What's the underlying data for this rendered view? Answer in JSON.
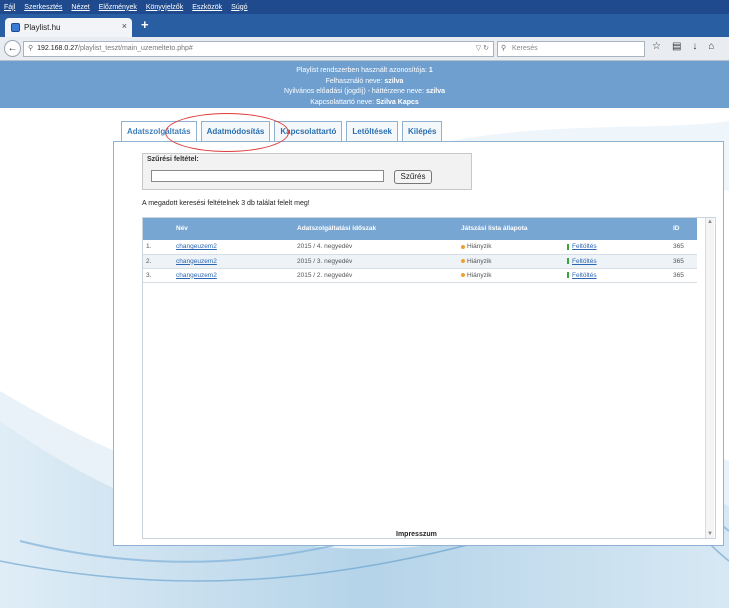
{
  "browser": {
    "menu": [
      "Fájl",
      "Szerkesztés",
      "Nézet",
      "Előzmények",
      "Könyvjelzők",
      "Eszközök",
      "Súgó"
    ],
    "tab_title": "Playlist.hu",
    "tab_close": "×",
    "new_tab": "+",
    "url_host": "192.168.0.27",
    "url_path": "/playlist_teszt/main_uzemelteto.php#",
    "search_placeholder": "Keresés"
  },
  "header": {
    "id_label": "Playlist rendszerben használt azonosítója:",
    "id_value": "1",
    "user_label": "Felhasználó neve:",
    "user_value": "szilva",
    "registry_label": "Nyilvános előadási (jogdíj) - háttérzene neve:",
    "registry_value": "szilva",
    "contact_label": "Kapcsolattartó neve:",
    "contact_value": "Szilva Kapcs"
  },
  "tabs": [
    "Adatszolgáltatás",
    "Adatmódosítás",
    "Kapcsolattartó",
    "Letöltések",
    "Kilépés"
  ],
  "filter": {
    "legend": "Szűrési feltétel:",
    "input_value": "",
    "button": "Szűrés"
  },
  "result_message": "A megadott keresési feltételnek 3 db találat felelt meg!",
  "table": {
    "columns": [
      "Név",
      "Adatszolgáltatási időszak",
      "Játszási lista állapota",
      "",
      "ID"
    ],
    "rows": [
      {
        "num": "1.",
        "name": "changeuzem2",
        "period": "2015 / 4. negyedév",
        "status": "Hiányzik",
        "action": "Feltöltés",
        "id": "365"
      },
      {
        "num": "2.",
        "name": "changeuzem2",
        "period": "2015 / 3. negyedév",
        "status": "Hiányzik",
        "action": "Feltöltés",
        "id": "365"
      },
      {
        "num": "3.",
        "name": "changeuzem2",
        "period": "2015 / 2. negyedév",
        "status": "Hiányzik",
        "action": "Feltöltés",
        "id": "365"
      }
    ]
  },
  "footer": {
    "impresszum": "Impresszum"
  },
  "colors": {
    "header_band": "#6f9fcf",
    "table_header": "#78a6d3",
    "highlight_oval": "#e03a3a",
    "link": "#2b66b3"
  }
}
